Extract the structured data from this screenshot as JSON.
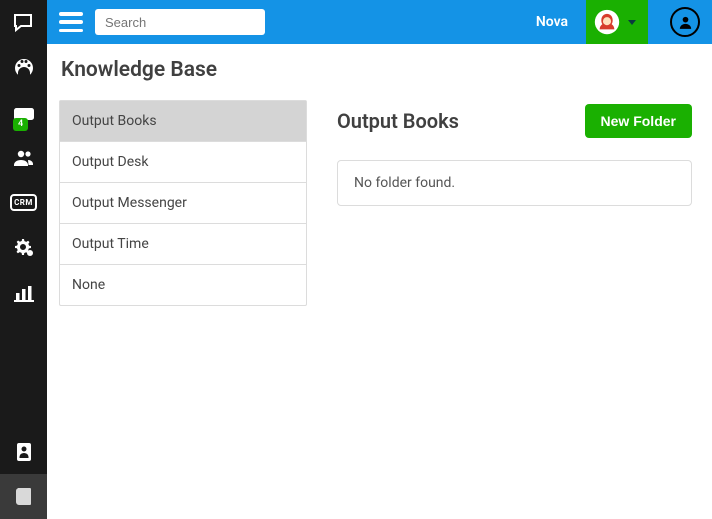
{
  "topbar": {
    "search_placeholder": "Search",
    "username": "Nova"
  },
  "sidebar": {
    "badge_count": "4"
  },
  "page": {
    "title": "Knowledge Base"
  },
  "categories": [
    {
      "label": "Output Books",
      "selected": true
    },
    {
      "label": "Output Desk",
      "selected": false
    },
    {
      "label": "Output Messenger",
      "selected": false
    },
    {
      "label": "Output Time",
      "selected": false
    },
    {
      "label": "None",
      "selected": false
    }
  ],
  "detail": {
    "title": "Output Books",
    "new_folder_label": "New Folder",
    "empty_message": "No folder found."
  }
}
